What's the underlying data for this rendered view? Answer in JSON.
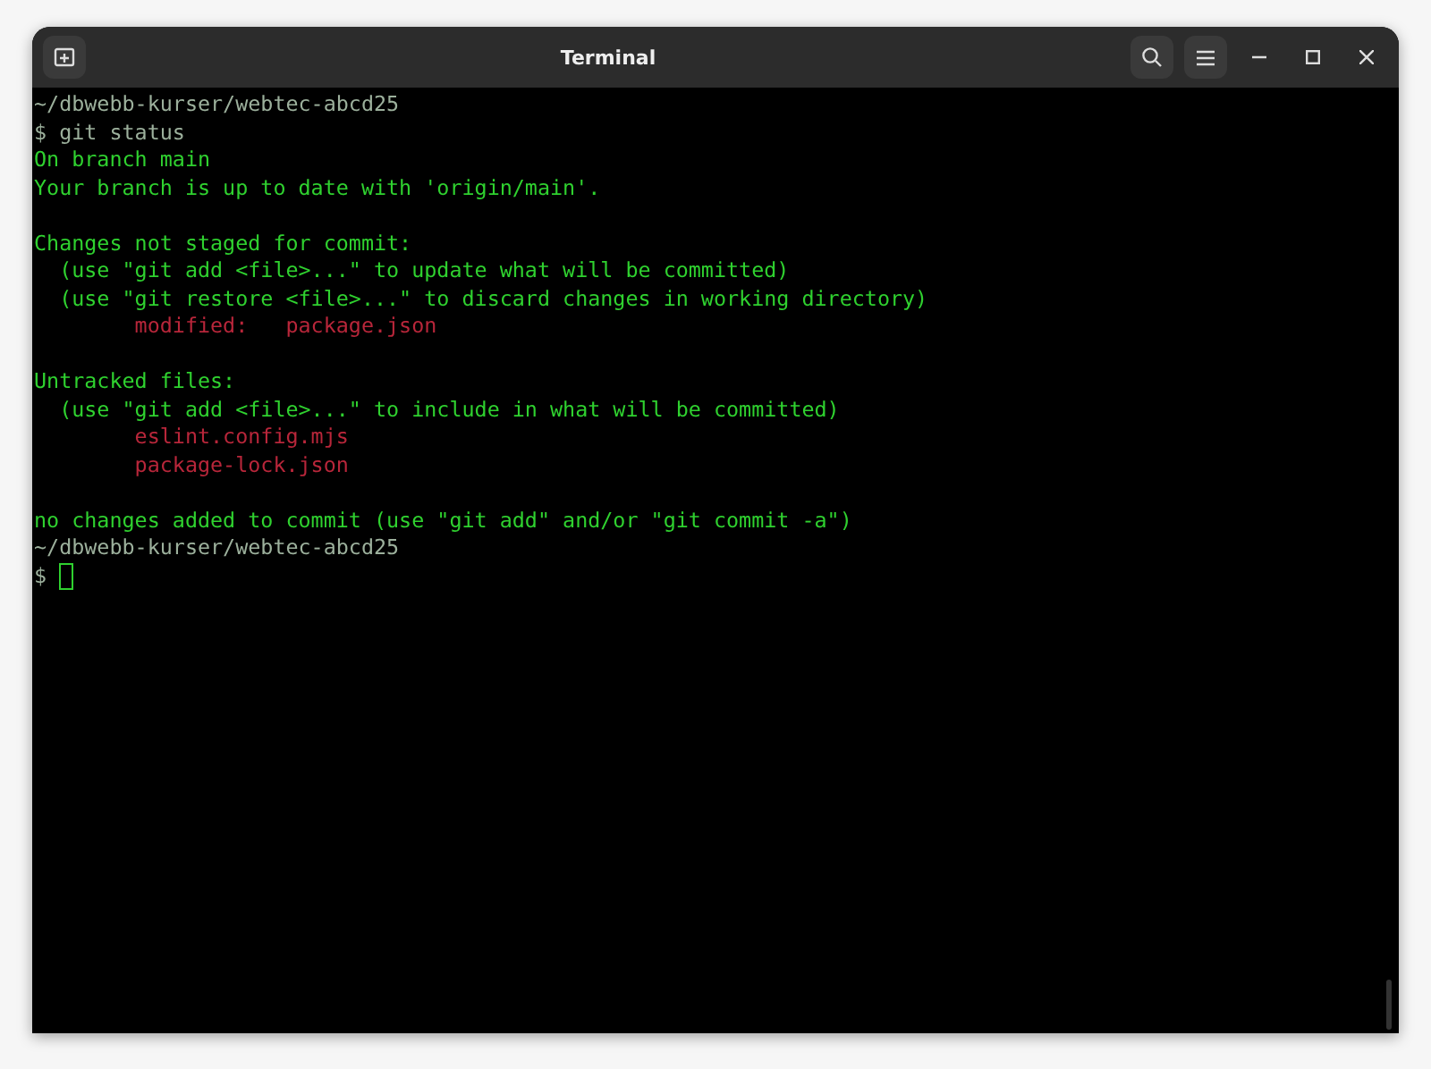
{
  "window": {
    "title": "Terminal"
  },
  "lines": [
    {
      "kind": "path",
      "text": "~/dbwebb-kurser/webtec-abcd25"
    },
    {
      "kind": "prompt",
      "symbol": "$",
      "command": "git status",
      "cursor": false
    },
    {
      "kind": "output",
      "text": "On branch main"
    },
    {
      "kind": "output",
      "text": "Your branch is up to date with 'origin/main'."
    },
    {
      "kind": "blank"
    },
    {
      "kind": "output",
      "text": "Changes not staged for commit:"
    },
    {
      "kind": "output",
      "text": "  (use \"git add <file>...\" to update what will be committed)"
    },
    {
      "kind": "output",
      "text": "  (use \"git restore <file>...\" to discard changes in working directory)"
    },
    {
      "kind": "file",
      "text": "        modified:   package.json"
    },
    {
      "kind": "blank"
    },
    {
      "kind": "output",
      "text": "Untracked files:"
    },
    {
      "kind": "output",
      "text": "  (use \"git add <file>...\" to include in what will be committed)"
    },
    {
      "kind": "file",
      "text": "        eslint.config.mjs"
    },
    {
      "kind": "file",
      "text": "        package-lock.json"
    },
    {
      "kind": "blank"
    },
    {
      "kind": "output",
      "text": "no changes added to commit (use \"git add\" and/or \"git commit -a\")"
    },
    {
      "kind": "path",
      "text": "~/dbwebb-kurser/webtec-abcd25"
    },
    {
      "kind": "prompt",
      "symbol": "$",
      "cursor": true
    }
  ]
}
